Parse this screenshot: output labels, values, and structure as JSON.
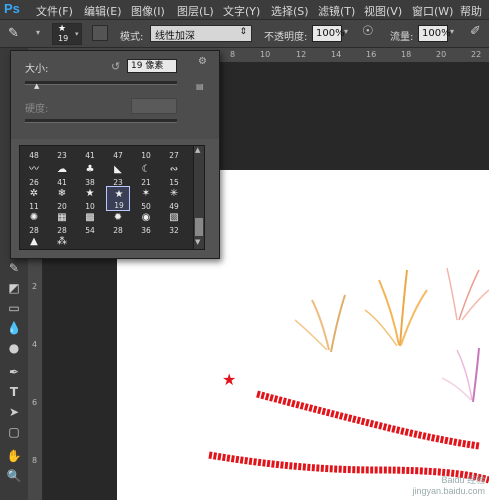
{
  "app": {
    "logo": "Ps"
  },
  "menubar": {
    "items": [
      "文件(F)",
      "编辑(E)",
      "图像(I)",
      "图层(L)",
      "文字(Y)",
      "选择(S)",
      "滤镜(T)",
      "视图(V)",
      "窗口(W)",
      "帮助"
    ]
  },
  "options": {
    "brush_size": "19",
    "mode_label": "模式:",
    "mode_value": "线性加深",
    "opacity_label": "不透明度:",
    "opacity_value": "100%",
    "flow_label": "流量:",
    "flow_value": "100%"
  },
  "brush_panel": {
    "size_label": "大小:",
    "size_value": "19 像素",
    "hardness_label": "硬度:",
    "hardness_value": "",
    "presets": [
      {
        "num": "48",
        "glyph": ""
      },
      {
        "num": "23",
        "glyph": ""
      },
      {
        "num": "41",
        "glyph": ""
      },
      {
        "num": "47",
        "glyph": ""
      },
      {
        "num": "10",
        "glyph": ""
      },
      {
        "num": "27",
        "glyph": ""
      },
      {
        "num": "26",
        "glyph": "〰"
      },
      {
        "num": "41",
        "glyph": "☁"
      },
      {
        "num": "38",
        "glyph": "♣"
      },
      {
        "num": "23",
        "glyph": "◣"
      },
      {
        "num": "21",
        "glyph": "☾"
      },
      {
        "num": "15",
        "glyph": "∾"
      },
      {
        "num": "11",
        "glyph": "✲"
      },
      {
        "num": "20",
        "glyph": "❄"
      },
      {
        "num": "10",
        "glyph": "★"
      },
      {
        "num": "19",
        "glyph": "★"
      },
      {
        "num": "50",
        "glyph": "✶"
      },
      {
        "num": "49",
        "glyph": "✳"
      },
      {
        "num": "28",
        "glyph": "✺"
      },
      {
        "num": "28",
        "glyph": "▦"
      },
      {
        "num": "54",
        "glyph": "▩"
      },
      {
        "num": "28",
        "glyph": "✹"
      },
      {
        "num": "36",
        "glyph": "◉"
      },
      {
        "num": "32",
        "glyph": "▧"
      },
      {
        "num": "",
        "glyph": "▲"
      },
      {
        "num": "",
        "glyph": "⁂"
      }
    ],
    "selected_index": 15
  },
  "rulers": {
    "top": [
      "8",
      "10",
      "12",
      "14",
      "16",
      "18",
      "20",
      "22"
    ],
    "left": [
      "2",
      "4",
      "6",
      "8"
    ]
  },
  "watermark": "Baidu 经验\njingyan.baidu.com",
  "colors": {
    "accent": "#36a9f5",
    "stroke_red": "#e0141a"
  }
}
